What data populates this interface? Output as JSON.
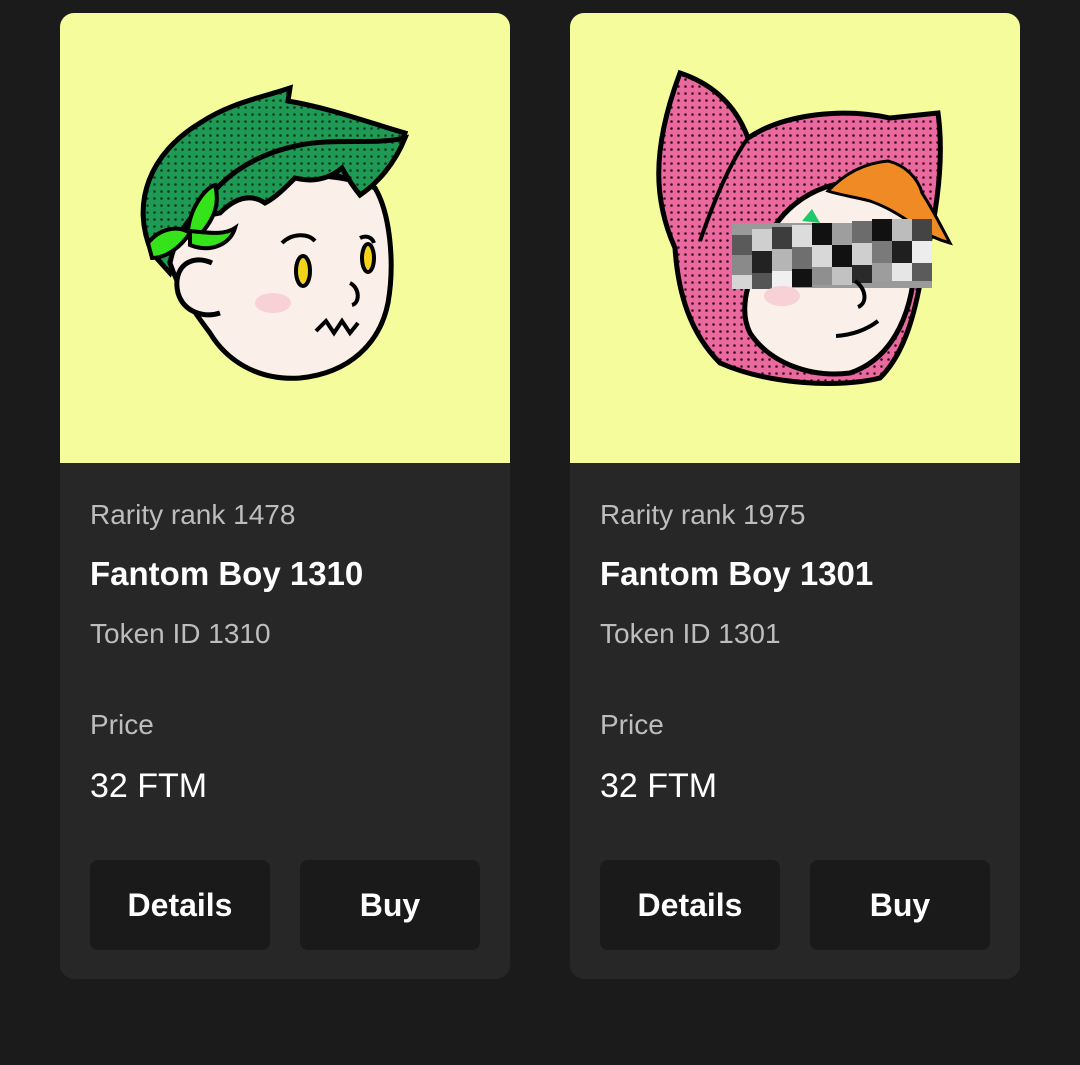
{
  "cards": [
    {
      "image": {
        "alt": "Fantom Boy 1310 artwork",
        "background": "#f4fc9b",
        "hair_color": "#1f9a55",
        "bow_color": "#35e31a"
      },
      "rarity": "Rarity rank 1478",
      "name": "Fantom Boy 1310",
      "token": "Token ID 1310",
      "price_label": "Price",
      "price": "32 FTM",
      "details_label": "Details",
      "buy_label": "Buy"
    },
    {
      "image": {
        "alt": "Fantom Boy 1301 artwork",
        "background": "#f4fc9b",
        "hood_color": "#ea6aa0",
        "hair_color": "#f08a24"
      },
      "rarity": "Rarity rank 1975",
      "name": "Fantom Boy 1301",
      "token": "Token ID 1301",
      "price_label": "Price",
      "price": "32 FTM",
      "details_label": "Details",
      "buy_label": "Buy"
    }
  ],
  "colors": {
    "page_background": "#1b1b1b",
    "card_background": "#272727",
    "button_background": "#1a1a1a",
    "muted_text": "#bdbdbd",
    "primary_text": "#ffffff"
  }
}
